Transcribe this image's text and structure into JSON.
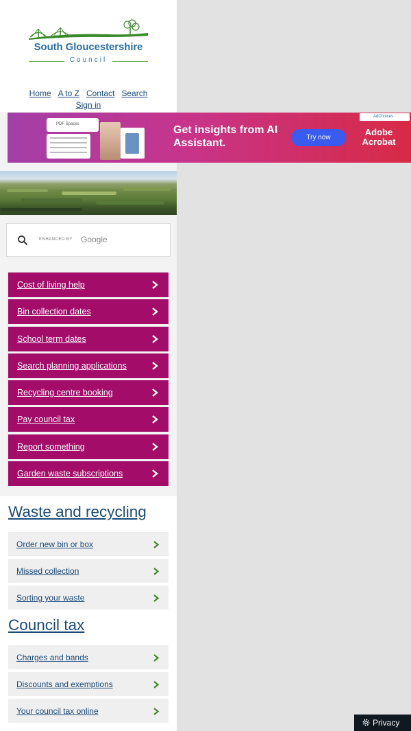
{
  "header": {
    "logo": {
      "name": "South Gloucestershire",
      "subtitle": "Council"
    },
    "nav": [
      {
        "label": "Home"
      },
      {
        "label": "A to Z"
      },
      {
        "label": "Contact"
      },
      {
        "label": "Search"
      },
      {
        "label": "Sign in"
      }
    ]
  },
  "ad": {
    "card_label": "PDF Spaces",
    "headline": "Get insights from AI Assistant.",
    "button": "Try now",
    "brand": "Adobe Acrobat",
    "choices": "AdChoices"
  },
  "search": {
    "enhanced": "ENHANCED BY",
    "provider": "Google"
  },
  "quick_links": [
    {
      "label": "Cost of living help"
    },
    {
      "label": "Bin collection dates"
    },
    {
      "label": "School term dates"
    },
    {
      "label": "Search planning applications"
    },
    {
      "label": "Recycling centre booking"
    },
    {
      "label": "Pay council tax"
    },
    {
      "label": "Report something"
    },
    {
      "label": "Garden waste subscriptions"
    }
  ],
  "sections": [
    {
      "title": "Waste and recycling",
      "items": [
        {
          "label": "Order new bin or box"
        },
        {
          "label": "Missed collection"
        },
        {
          "label": "Sorting your waste"
        }
      ]
    },
    {
      "title": "Council tax",
      "items": [
        {
          "label": "Charges and bands"
        },
        {
          "label": "Discounts and exemptions"
        },
        {
          "label": "Your council tax online"
        }
      ]
    }
  ],
  "privacy": {
    "label": "Privacy"
  },
  "colors": {
    "brand_blue": "#1b4a7a",
    "quick_link_magenta": "#a30c69",
    "chevron_green": "#3f8a2a",
    "logo_green": "#3a8a2a"
  }
}
